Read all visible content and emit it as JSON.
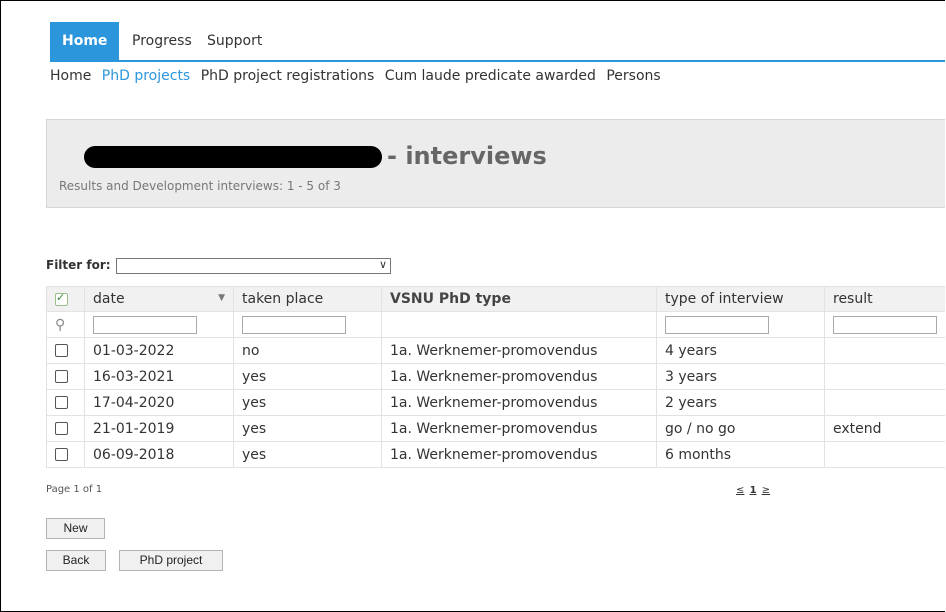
{
  "nav": {
    "tabs": [
      {
        "label": "Home",
        "active": true
      },
      {
        "label": "Progress",
        "active": false
      },
      {
        "label": "Support",
        "active": false
      }
    ],
    "accent": "#2b96dc"
  },
  "subnav": [
    "Home",
    "PhD projects",
    "PhD project registrations",
    "Cum laude predicate awarded",
    "Persons"
  ],
  "header": {
    "title_suffix": "- interviews",
    "subtitle": "Results and Development interviews: 1 - 5 of 3"
  },
  "filter": {
    "label": "Filter for:",
    "value": ""
  },
  "table": {
    "columns": [
      "date",
      "taken place",
      "VSNU PhD type",
      "type of interview",
      "result"
    ],
    "rows": [
      {
        "date": "01-03-2022",
        "taken_place": "no",
        "type": "1a. Werknemer-promovendus",
        "interview": "4 years",
        "result": ""
      },
      {
        "date": "16-03-2021",
        "taken_place": "yes",
        "type": "1a. Werknemer-promovendus",
        "interview": "3 years",
        "result": ""
      },
      {
        "date": "17-04-2020",
        "taken_place": "yes",
        "type": "1a. Werknemer-promovendus",
        "interview": "2 years",
        "result": ""
      },
      {
        "date": "21-01-2019",
        "taken_place": "yes",
        "type": "1a. Werknemer-promovendus",
        "interview": "go / no go",
        "result": "extend"
      },
      {
        "date": "06-09-2018",
        "taken_place": "yes",
        "type": "1a. Werknemer-promovendus",
        "interview": "6 months",
        "result": ""
      }
    ]
  },
  "footer": {
    "page_info": "Page 1 of 1",
    "pager_prev": "≤",
    "pager_current": "1",
    "pager_next": "≥"
  },
  "buttons": {
    "new": "New",
    "back": "Back",
    "phd_project": "PhD project"
  },
  "icons": {
    "filter_row": "magnifier-icon",
    "sort": "sort-down-icon",
    "select_all": "checkbox-checked-icon"
  }
}
